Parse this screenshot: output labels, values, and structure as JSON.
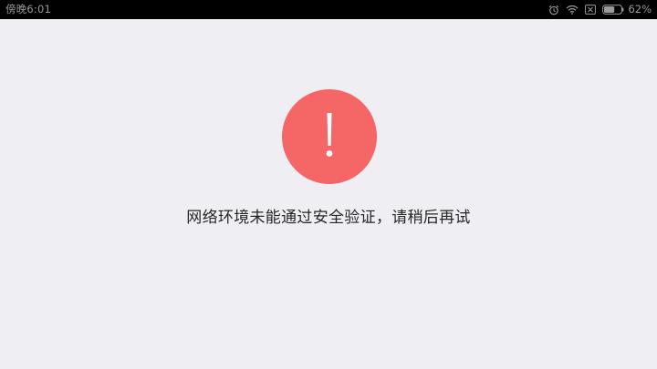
{
  "status_bar": {
    "time": "傍晚6:01",
    "battery_percent": "62%",
    "battery_level": 0.62,
    "icons": [
      "alarm-icon",
      "wifi-icon",
      "no-sim-icon",
      "battery-icon"
    ]
  },
  "error": {
    "icon": "exclamation-icon",
    "icon_color": "#f56666",
    "message": "网络环境未能通过安全验证，请稍后再试"
  }
}
